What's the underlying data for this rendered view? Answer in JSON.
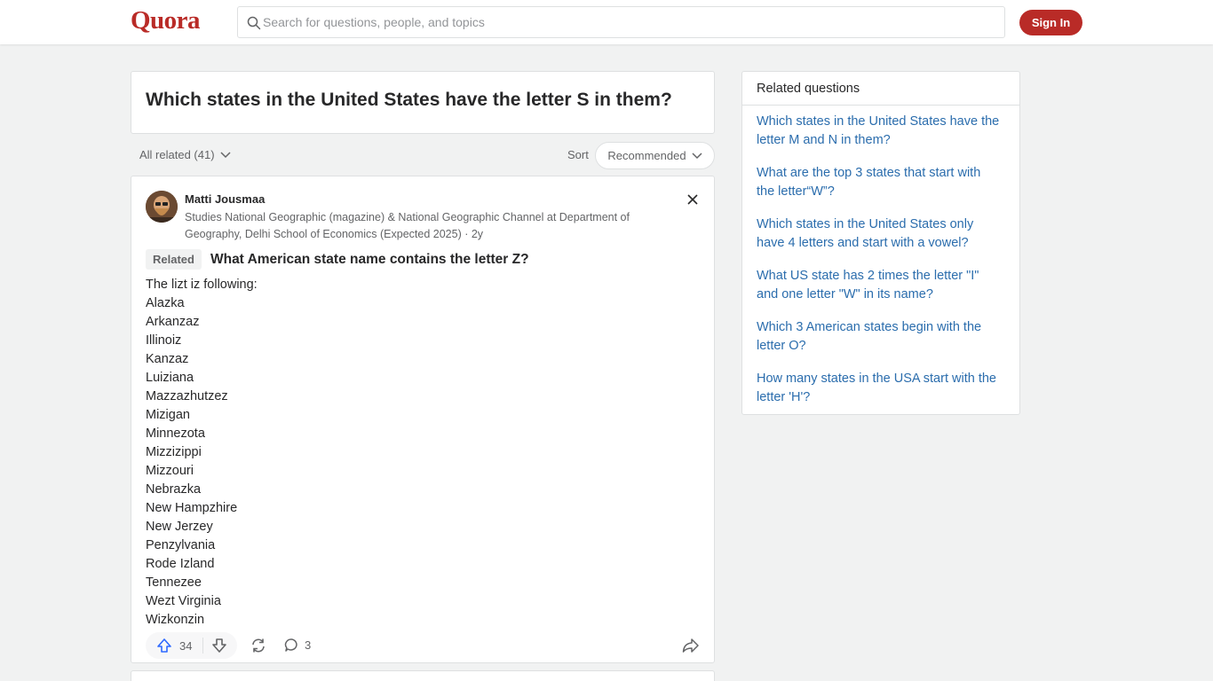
{
  "header": {
    "logo": "Quora",
    "search_placeholder": "Search for questions, people, and topics",
    "signin_label": "Sign In"
  },
  "question": {
    "title": "Which states in the United States have the letter S in them?"
  },
  "filters": {
    "all_related": "All related (41)",
    "sort_label": "Sort",
    "sort_value": "Recommended"
  },
  "answer": {
    "author": "Matti Jousmaa",
    "credential_line1": "Studies National Geographic (magazine) & National Geographic Channel at Department of",
    "credential_line2": "Geography, Delhi School of Economics (Expected 2025) · 2y",
    "related_tag": "Related",
    "related_question": "What American state name contains the letter Z?",
    "lines": [
      "The lizt iz following:",
      "Alazka",
      "Arkanzaz",
      "Illinoiz",
      "Kanzaz",
      "Luiziana",
      "Mazzazhutzez",
      "Mizigan",
      "Minnezota",
      "Mizzizippi",
      "Mizzouri",
      "Nebrazka",
      "New Hampzhire",
      "New Jerzey",
      "Penzylvania",
      "Rode Izland",
      "Tennezee",
      "Wezt Virginia",
      "Wizkonzin"
    ],
    "upvotes": "34",
    "comments": "3"
  },
  "sidebar": {
    "title": "Related questions",
    "items": [
      {
        "line1": "Which states in the United States have the",
        "line2": "letter M and N in them?"
      },
      {
        "line1": "What are the top 3 states that start with",
        "line2": "the letter“W”?"
      },
      {
        "line1": "Which states in the United States only",
        "line2": "have 4 letters and start with a vowel?"
      },
      {
        "line1": "What US state has 2 times the letter \"I\"",
        "line2": "and one letter \"W\" in its name?"
      },
      {
        "line1": "Which 3 American states begin with the",
        "line2": "letter O?"
      },
      {
        "line1": "How many states in the USA start with the",
        "line2": "letter 'H'?"
      }
    ]
  },
  "colors": {
    "brand": "#b92b27",
    "link": "#2b6dad",
    "upvote": "#2e69ff"
  }
}
